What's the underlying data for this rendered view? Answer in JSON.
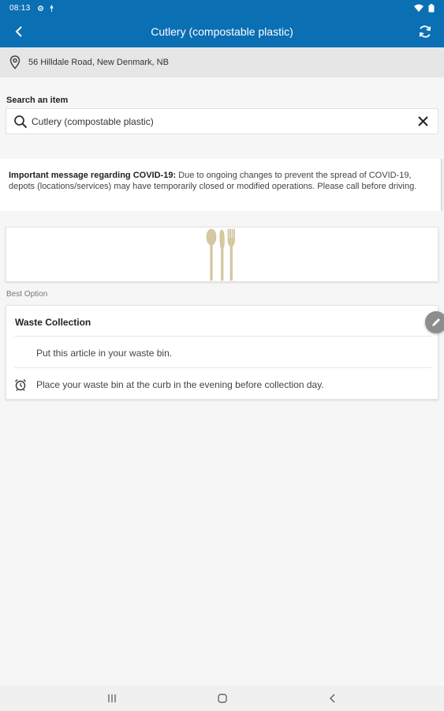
{
  "status_bar": {
    "time": "08:13",
    "icons": [
      "gear-icon",
      "notification-icon",
      "wifi-icon",
      "battery-icon"
    ]
  },
  "app_bar": {
    "title": "Cutlery (compostable plastic)",
    "icons": [
      "back-arrow-icon",
      "refresh-icon"
    ]
  },
  "address": {
    "text": "56 Hilldale Road, New Denmark, NB",
    "icon": "location-pin-icon"
  },
  "search": {
    "label": "Search an item",
    "value": "Cutlery (compostable plastic)",
    "icons": [
      "search-icon",
      "clear-icon"
    ]
  },
  "notice": {
    "heading": "Important message regarding COVID-19:",
    "body": "Due to ongoing changes to prevent the spread of COVID-19, depots (locations/services) may have temporarily closed or modified operations. Please call before driving."
  },
  "item_image": {
    "icon": "cutlery-icon"
  },
  "best_option": {
    "label": "Best Option",
    "card_title": "Waste Collection",
    "rows": [
      {
        "text": "Put this article in your waste bin.",
        "icon": ""
      },
      {
        "text": "Place your waste bin at the curb in the evening before collection day.",
        "icon": "alarm-clock-icon"
      }
    ],
    "edit_icon": "pencil-icon"
  },
  "nav_bar": {
    "icons": [
      "recent-apps-icon",
      "home-icon",
      "back-icon"
    ]
  },
  "colors": {
    "primary": "#0a6fb3",
    "cutlery": "#d6c9a2"
  }
}
